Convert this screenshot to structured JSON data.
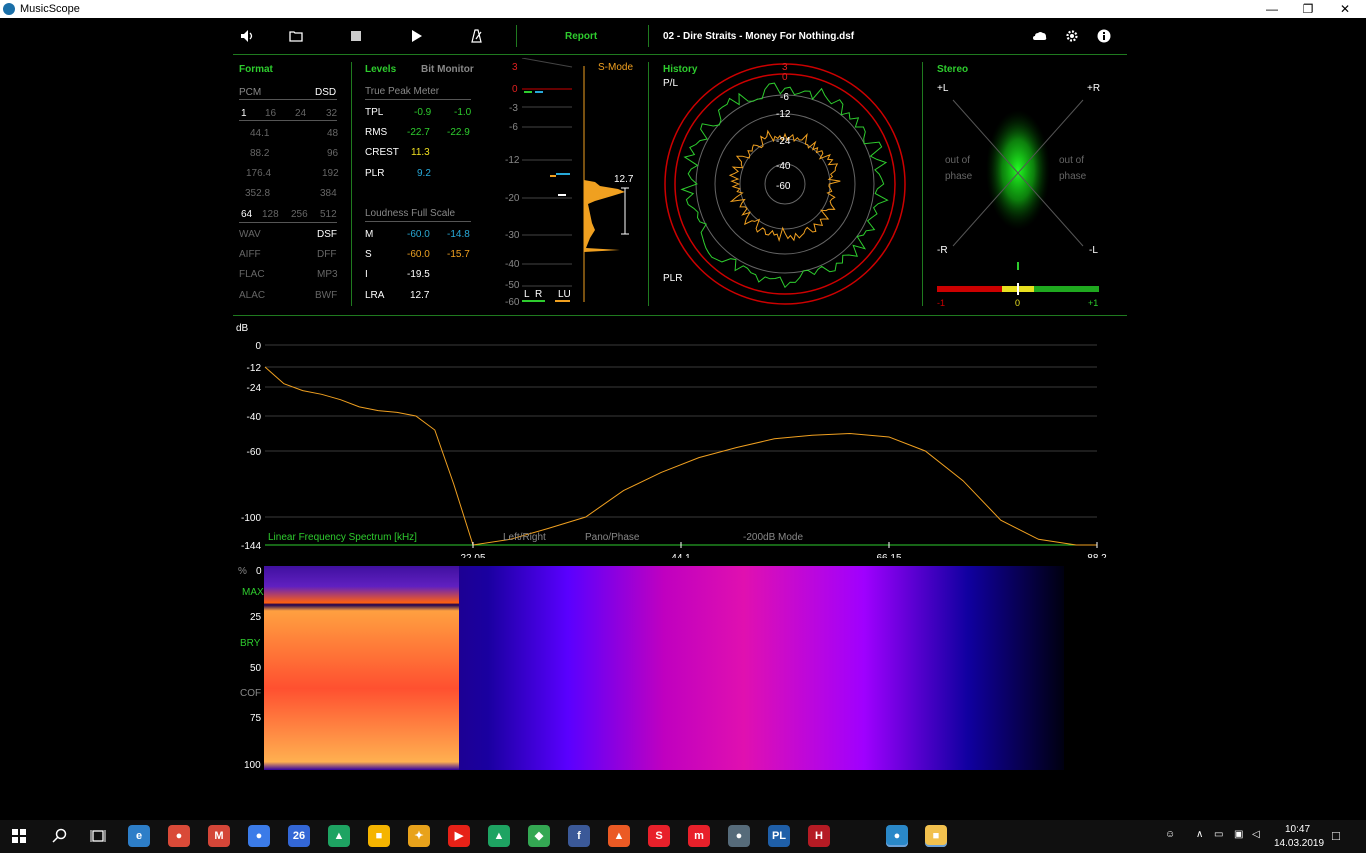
{
  "window": {
    "title": "MusicScope",
    "minimize": "—",
    "restore": "❐",
    "close": "✕"
  },
  "toolbar": {
    "report_label": "Report",
    "file_name": "02 - Dire Straits - Money For Nothing.dsf",
    "icons": [
      "volume-icon",
      "folder-icon",
      "stop-icon",
      "play-icon",
      "metronome-icon",
      "cloud-icon",
      "gear-icon",
      "info-icon"
    ]
  },
  "format": {
    "title": "Format",
    "pcm": "PCM",
    "dsd": "DSD",
    "bits": [
      "1",
      "16",
      "24",
      "32"
    ],
    "rates_left": [
      "44.1",
      "88.2",
      "176.4",
      "352.8"
    ],
    "rates_right": [
      "48",
      "96",
      "192",
      "384"
    ],
    "dsd_rates": [
      "64",
      "128",
      "256",
      "512"
    ],
    "types_left": [
      "WAV",
      "AIFF",
      "FLAC",
      "ALAC"
    ],
    "types_right": [
      "DSF",
      "DFF",
      "MP3",
      "BWF"
    ]
  },
  "levels": {
    "title": "Levels",
    "bit_monitor": "Bit Monitor",
    "true_peak_title": "True Peak Meter",
    "tpl": {
      "label": "TPL",
      "l": "-0.9",
      "r": "-1.0"
    },
    "rms": {
      "label": "RMS",
      "l": "-22.7",
      "r": "-22.9"
    },
    "crest": {
      "label": "CREST",
      "v": "11.3"
    },
    "plr": {
      "label": "PLR",
      "v": "9.2"
    },
    "loudness_title": "Loudness Full Scale",
    "m": {
      "label": "M",
      "a": "-60.0",
      "b": "-14.8"
    },
    "s": {
      "label": "S",
      "a": "-60.0",
      "b": "-15.7"
    },
    "i": {
      "label": "I",
      "v": "-19.5"
    },
    "lra": {
      "label": "LRA",
      "v": "12.7"
    }
  },
  "meter": {
    "smode": "S-Mode",
    "scale": [
      "3",
      "0",
      "-3",
      "-6",
      "-12",
      "-20",
      "-30",
      "-40",
      "-50",
      "-60"
    ],
    "l": "L",
    "r": "R",
    "lu": "LU",
    "lra_value": "12.7"
  },
  "history": {
    "title": "History",
    "pl": "P/L",
    "plr": "PLR",
    "rings": [
      "3",
      "0",
      "-6",
      "-12",
      "-24",
      "-40",
      "-60"
    ]
  },
  "stereo": {
    "title": "Stereo",
    "plus_l": "+L",
    "plus_r": "+R",
    "minus_r": "-R",
    "minus_l": "-L",
    "out_of": "out of",
    "phase": "phase",
    "corr_min": "-1",
    "corr_mid": "0",
    "corr_max": "+1"
  },
  "spectrum": {
    "db_label": "dB",
    "y_ticks": [
      "0",
      "-12",
      "-24",
      "-40",
      "-60",
      "-100",
      "-144"
    ],
    "title": "Linear Frequency Spectrum [kHz]",
    "x_ticks": [
      "22.05",
      "44.1",
      "66.15",
      "88.2"
    ],
    "mode_left_right": "Left/Right",
    "mode_pano_phase": "Pano/Phase",
    "mode_200db": "-200dB Mode"
  },
  "chart_data": {
    "type": "line",
    "title": "Linear Frequency Spectrum [kHz]",
    "xlabel": "",
    "ylabel": "dB",
    "xlim": [
      0,
      88.2
    ],
    "ylim": [
      -144,
      0
    ],
    "x": [
      0,
      2,
      4,
      6,
      8,
      10,
      12,
      14,
      16,
      18,
      20,
      22.05,
      26,
      30,
      34,
      38,
      42,
      46,
      50,
      54,
      58,
      62,
      66.15,
      70,
      74,
      78,
      82,
      86,
      88.2
    ],
    "series": [
      {
        "values": [
          -12,
          -22,
          -26,
          -28,
          -31,
          -35,
          -37,
          -38,
          -40,
          -48,
          -80,
          -144,
          -135,
          -118,
          -100,
          -84,
          -73,
          -64,
          -58,
          -53,
          -51,
          -50,
          -52,
          -60,
          -78,
          -105,
          -135,
          -144,
          -144
        ]
      }
    ],
    "grid": true
  },
  "spectrogram": {
    "pct": "%",
    "ticks": [
      "0",
      "25",
      "50",
      "75",
      "100"
    ],
    "markers": {
      "max": "MAX",
      "bry": "BRY",
      "cof": "COF"
    }
  },
  "taskbar": {
    "time": "10:47",
    "date": "14.03.2019",
    "apps": [
      {
        "name": "edge-icon",
        "glyph": "e",
        "color": "#2d7ec8"
      },
      {
        "name": "chrome-icon",
        "glyph": "●",
        "color": "#d94a38"
      },
      {
        "name": "gmail-icon",
        "glyph": "M",
        "color": "#d44638"
      },
      {
        "name": "messenger-icon",
        "glyph": "●",
        "color": "#3b7be8"
      },
      {
        "name": "calendar-icon",
        "glyph": "26",
        "color": "#3367d6"
      },
      {
        "name": "drive-icon",
        "glyph": "▲",
        "color": "#1ea362"
      },
      {
        "name": "keep-icon",
        "glyph": "■",
        "color": "#f5b400"
      },
      {
        "name": "photos-icon",
        "glyph": "✦",
        "color": "#e8a21b"
      },
      {
        "name": "youtube-icon",
        "glyph": "▶",
        "color": "#e62117"
      },
      {
        "name": "drive2-icon",
        "glyph": "▲",
        "color": "#1ea362"
      },
      {
        "name": "maps-icon",
        "glyph": "◆",
        "color": "#34a853"
      },
      {
        "name": "facebook-icon",
        "glyph": "f",
        "color": "#3b5998"
      },
      {
        "name": "office-icon",
        "glyph": "▲",
        "color": "#eb5a24"
      },
      {
        "name": "app-s-icon",
        "glyph": "S",
        "color": "#e8202a"
      },
      {
        "name": "app-m-icon",
        "glyph": "m",
        "color": "#e8202a"
      },
      {
        "name": "resolve-icon",
        "glyph": "●",
        "color": "#566b7a"
      },
      {
        "name": "pl-icon",
        "glyph": "PL",
        "color": "#1f5fa8"
      },
      {
        "name": "app-h-icon",
        "glyph": "H",
        "color": "#b51b24"
      },
      {
        "name": "musicscope-icon",
        "glyph": "●",
        "color": "#2a88c8"
      },
      {
        "name": "explorer-icon",
        "glyph": "■",
        "color": "#f2c14e"
      }
    ]
  }
}
